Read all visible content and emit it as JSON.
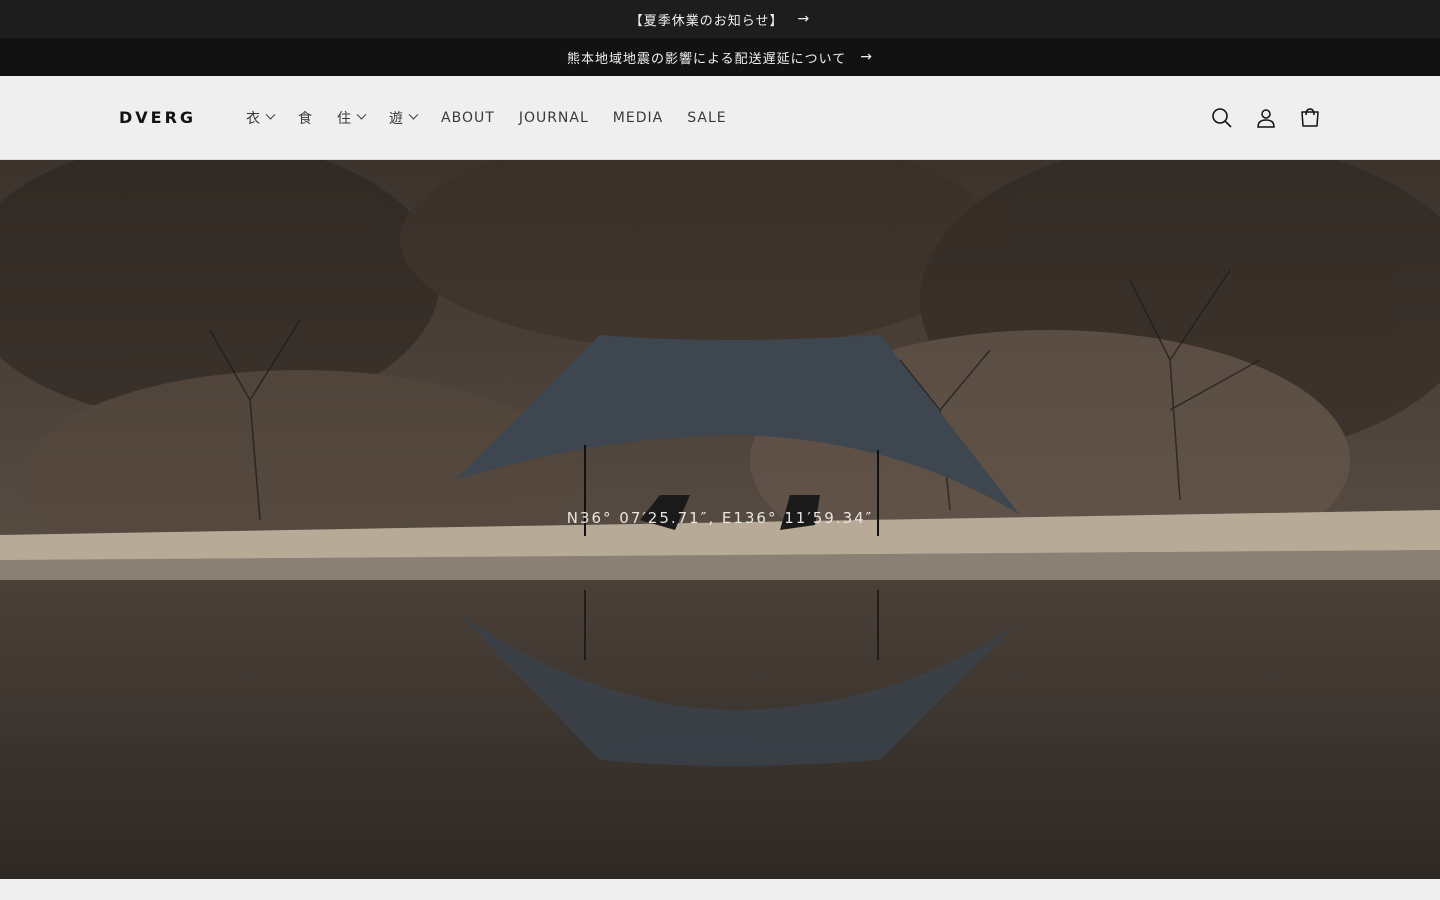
{
  "announcements": [
    {
      "text": "【夏季休業のお知らせ】",
      "arrow": "→"
    },
    {
      "text": "熊本地域地震の影響による配送遅延について",
      "arrow": "→"
    }
  ],
  "header": {
    "logo": "DVERG",
    "nav": [
      {
        "label": "衣",
        "dropdown": true
      },
      {
        "label": "食",
        "dropdown": false
      },
      {
        "label": "住",
        "dropdown": true
      },
      {
        "label": "遊",
        "dropdown": true
      },
      {
        "label": "ABOUT",
        "dropdown": false
      },
      {
        "label": "JOURNAL",
        "dropdown": false
      },
      {
        "label": "MEDIA",
        "dropdown": false
      },
      {
        "label": "SALE",
        "dropdown": false
      }
    ],
    "icons": [
      "search-icon",
      "account-icon",
      "cart-icon"
    ]
  },
  "hero": {
    "caption": "N36° 07′25.71″, E136° 11′59.34″"
  }
}
